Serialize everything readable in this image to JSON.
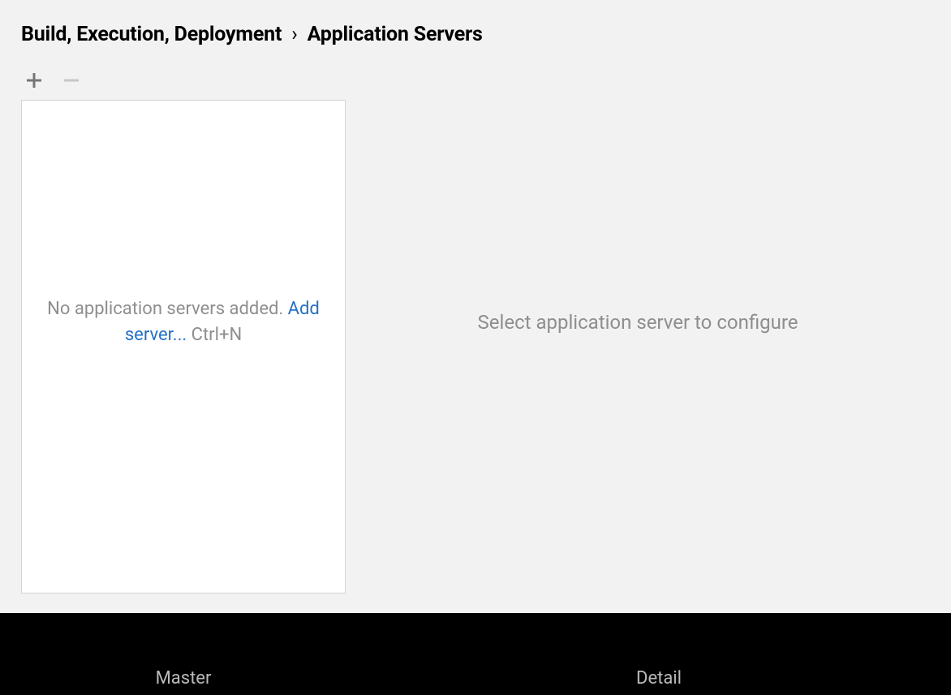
{
  "breadcrumb": {
    "parent": "Build, Execution, Deployment",
    "separator": "›",
    "current": "Application Servers"
  },
  "toolbar": {
    "add_label": "Add",
    "remove_label": "Remove"
  },
  "master": {
    "empty_text_prefix": "No application servers added. ",
    "add_link": "Add server...",
    "shortcut": " Ctrl+N"
  },
  "detail": {
    "empty_text": "Select application server to configure"
  },
  "footer": {
    "master_label": "Master",
    "detail_label": "Detail"
  }
}
